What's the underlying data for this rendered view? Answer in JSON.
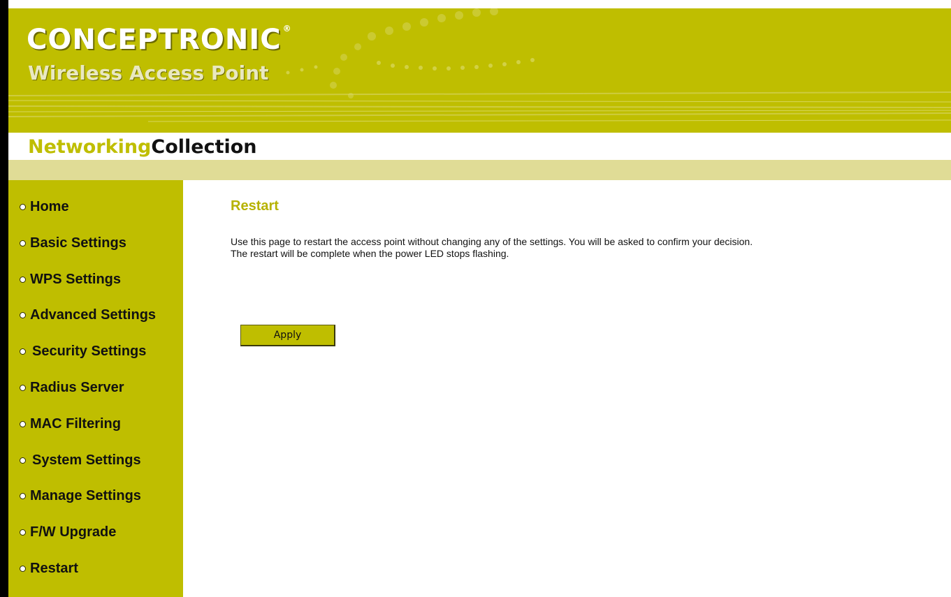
{
  "header": {
    "brand": "CONCEPTRONIC",
    "brand_mark": "®",
    "subtitle": "Wireless Access Point",
    "collection_part1": "Networking",
    "collection_part2": "Collection"
  },
  "sidebar": {
    "items": [
      {
        "label": "Home"
      },
      {
        "label": "Basic Settings"
      },
      {
        "label": "WPS Settings"
      },
      {
        "label": "Advanced Settings"
      },
      {
        "label": "Security Settings"
      },
      {
        "label": "Radius Server"
      },
      {
        "label": "MAC Filtering"
      },
      {
        "label": "System Settings"
      },
      {
        "label": "Manage Settings"
      },
      {
        "label": "F/W Upgrade"
      },
      {
        "label": "Restart"
      }
    ]
  },
  "main": {
    "title": "Restart",
    "description_line1": "Use this page to restart the access point without changing any of the settings. You will be asked to confirm your decision.",
    "description_line2": "The restart will be complete when the power LED stops flashing.",
    "apply_label": "Apply"
  },
  "colors": {
    "brand_olive": "#bfbe00",
    "stripe": "#e0dc96",
    "title_color": "#b6b200"
  }
}
